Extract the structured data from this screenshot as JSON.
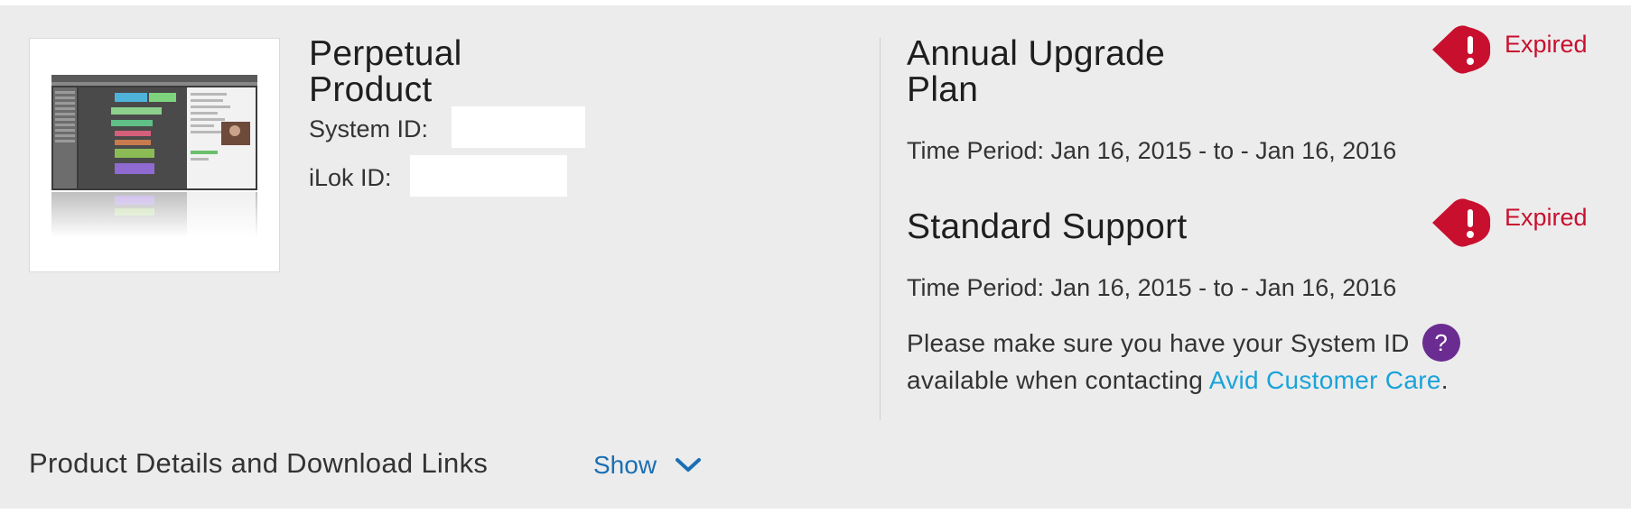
{
  "product": {
    "title": "Perpetual Product",
    "system_id_label": "System ID:",
    "system_id_value": "",
    "ilok_id_label": "iLok ID:",
    "ilok_id_value": "",
    "thumbnail_icon": "daw-screenshot-thumbnail"
  },
  "plans": [
    {
      "title": "Annual Upgrade Plan",
      "status": "Expired",
      "status_icon": "alert-icon",
      "period": "Time Period: Jan 16, 2015 - to - Jan 16, 2016"
    },
    {
      "title": "Standard Support",
      "status": "Expired",
      "status_icon": "alert-icon",
      "period": "Time Period: Jan 16, 2015 - to - Jan 16, 2016"
    }
  ],
  "note": {
    "text_before": "Please make sure you have your System ID",
    "help_icon": "?",
    "text_middle": "available when contacting",
    "link_text": "Avid Customer Care",
    "text_after": "."
  },
  "footer": {
    "title": "Product Details and Download Links",
    "toggle_label": "Show"
  },
  "colors": {
    "expired": "#c8102e",
    "link": "#1aa3d9",
    "toggle": "#1b6fb5",
    "help_badge": "#6b2c91",
    "card_bg": "#ececec"
  }
}
